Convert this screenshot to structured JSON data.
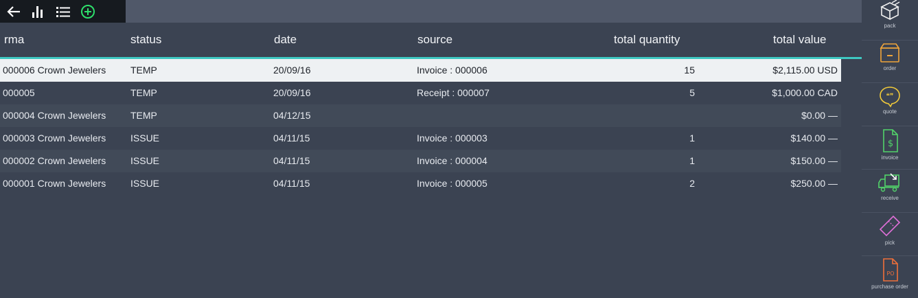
{
  "toolbar": {
    "icons": [
      "back-arrow-icon",
      "bar-chart-icon",
      "list-icon",
      "add-circle-icon"
    ],
    "add_color": "#2ee06b"
  },
  "table": {
    "headers": {
      "rma": "rma",
      "status": "status",
      "date": "date",
      "source": "source",
      "total_quantity": "total quantity",
      "total_value": "total value"
    },
    "rows": [
      {
        "rma": "000006 Crown Jewelers",
        "status": "TEMP",
        "date": "20/09/16",
        "source": "Invoice : 000006",
        "qty": "15",
        "value": "$2,115.00 USD"
      },
      {
        "rma": "000005",
        "status": "TEMP",
        "date": "20/09/16",
        "source": "Receipt : 000007",
        "qty": "5",
        "value": "$1,000.00 CAD"
      },
      {
        "rma": "000004 Crown Jewelers",
        "status": "TEMP",
        "date": "04/12/15",
        "source": "",
        "qty": "",
        "value": "$0.00 —"
      },
      {
        "rma": "000003 Crown Jewelers",
        "status": "ISSUE",
        "date": "04/11/15",
        "source": "Invoice : 000003",
        "qty": "1",
        "value": "$140.00 —"
      },
      {
        "rma": "000002 Crown Jewelers",
        "status": "ISSUE",
        "date": "04/11/15",
        "source": "Invoice : 000004",
        "qty": "1",
        "value": "$150.00 —"
      },
      {
        "rma": "000001 Crown Jewelers",
        "status": "ISSUE",
        "date": "04/11/15",
        "source": "Invoice : 000005",
        "qty": "2",
        "value": "$250.00 —"
      }
    ],
    "selected_row": 0,
    "accent": "#3ec8c2"
  },
  "sidebar": {
    "items": [
      {
        "label": "pack",
        "icon": "box-icon",
        "color": "#f2f2f2"
      },
      {
        "label": "order",
        "icon": "order-box-icon",
        "color": "#f0a53a"
      },
      {
        "label": "quote",
        "icon": "quote-bubble-icon",
        "color": "#f0c93a"
      },
      {
        "label": "invoice",
        "icon": "invoice-dollar-icon",
        "color": "#52d46a"
      },
      {
        "label": "receive",
        "icon": "truck-icon",
        "color": "#52d46a"
      },
      {
        "label": "pick",
        "icon": "ticket-icon",
        "color": "#e06fd8"
      },
      {
        "label": "purchase order",
        "icon": "po-document-icon",
        "color": "#f0703a"
      }
    ]
  }
}
